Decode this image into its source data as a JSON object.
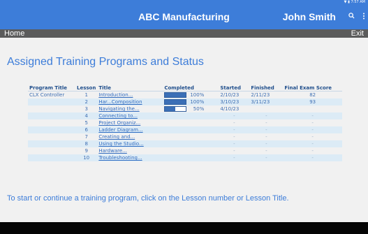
{
  "status_bar": {
    "icons": "▼ ▮ 7:57 AM"
  },
  "header": {
    "title": "ABC Manufacturing",
    "user": "John Smith",
    "search_icon": "search-icon",
    "menu_icon": "more-vert-icon",
    "accent_color": "#3d7dd9"
  },
  "nav": {
    "home_label": "Home",
    "exit_label": "Exit"
  },
  "page_title": "Assigned Training Programs and Status",
  "table": {
    "headers": [
      "Program Title",
      "Lesson",
      "Title",
      "Completed",
      "Started",
      "Finished",
      "Final Exam Score"
    ],
    "rows": [
      {
        "program": "CLX Controller",
        "lesson": "1",
        "title": "Introduction...",
        "completed_pct": 100,
        "completed": "100%",
        "started": "2/10/23",
        "finished": "2/11/23",
        "score": "82"
      },
      {
        "program": "",
        "lesson": "2",
        "title": "Har...Composition",
        "completed_pct": 100,
        "completed": "100%",
        "started": "3/10/23",
        "finished": "3/11/23",
        "score": "93"
      },
      {
        "program": "",
        "lesson": "3",
        "title": "Navigating the...",
        "completed_pct": 50,
        "completed": "50%",
        "started": "4/10/23",
        "finished": "",
        "score": ""
      },
      {
        "program": "",
        "lesson": "4",
        "title": "Connecting to...",
        "completed_pct": null,
        "completed": "",
        "started": "-",
        "finished": "-",
        "score": "-"
      },
      {
        "program": "",
        "lesson": "5",
        "title": "Project Organiz...",
        "completed_pct": null,
        "completed": "",
        "started": "-",
        "finished": "-",
        "score": "-"
      },
      {
        "program": "",
        "lesson": "6",
        "title": "Ladder Diagram...",
        "completed_pct": null,
        "completed": "",
        "started": "-",
        "finished": "-",
        "score": "-"
      },
      {
        "program": "",
        "lesson": "7",
        "title": "Creating and...",
        "completed_pct": null,
        "completed": "",
        "started": "-",
        "finished": "-",
        "score": "-"
      },
      {
        "program": "",
        "lesson": "8",
        "title": "Using the Studio...",
        "completed_pct": null,
        "completed": "",
        "started": "-",
        "finished": "-",
        "score": "-"
      },
      {
        "program": "",
        "lesson": "9",
        "title": "Hardware...",
        "completed_pct": null,
        "completed": "",
        "started": "-",
        "finished": "-",
        "score": "-"
      },
      {
        "program": "",
        "lesson": "10",
        "title": "Troubleshooting...",
        "completed_pct": null,
        "completed": "",
        "started": "-",
        "finished": "-",
        "score": "-"
      }
    ]
  },
  "footer_text": "To start or continue a training program, click on the Lesson number or Lesson Title."
}
